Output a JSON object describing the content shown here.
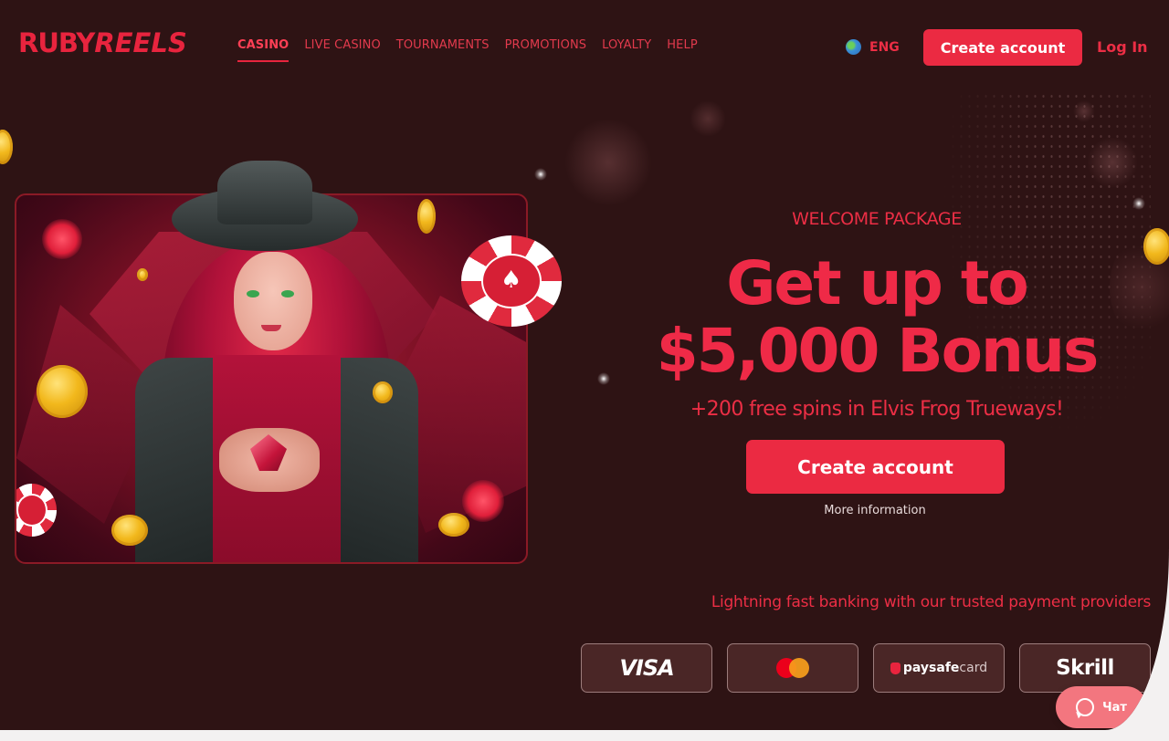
{
  "brand": {
    "logo_part1": "RUBY",
    "logo_part2": "REELS",
    "accent_color": "#eb2a42",
    "background_color": "#2e1314"
  },
  "nav": {
    "items": [
      {
        "label": "CASINO",
        "active": true
      },
      {
        "label": "LIVE CASINO",
        "active": false
      },
      {
        "label": "TOURNAMENTS",
        "active": false
      },
      {
        "label": "PROMOTIONS",
        "active": false
      },
      {
        "label": "LOYALTY",
        "active": false
      },
      {
        "label": "HELP",
        "active": false
      }
    ]
  },
  "header": {
    "language": "ENG",
    "language_icon": "globe-icon",
    "create_account_label": "Create account",
    "login_label": "Log In"
  },
  "hero": {
    "eyebrow": "WELCOME PACKAGE",
    "headline_line1": "Get up to",
    "headline_line2": "$5,000 Bonus",
    "subline": "+200 free spins in Elvis Frog Trueways!",
    "cta_label": "Create account",
    "more_info_label": "More information",
    "image_icon": "cowgirl-with-ruby-illustration"
  },
  "payments": {
    "title": "Lightning fast banking with our trusted payment providers",
    "providers": [
      {
        "name": "VISA",
        "icon": "visa-logo"
      },
      {
        "name": "Mastercard",
        "icon": "mastercard-logo"
      },
      {
        "name_bold": "paysafe",
        "name_light": "card",
        "icon": "paysafecard-logo"
      },
      {
        "name": "Skrill",
        "icon": "skrill-logo"
      }
    ]
  },
  "chat": {
    "label": "Чат",
    "icon": "chat-bubble-icon"
  }
}
